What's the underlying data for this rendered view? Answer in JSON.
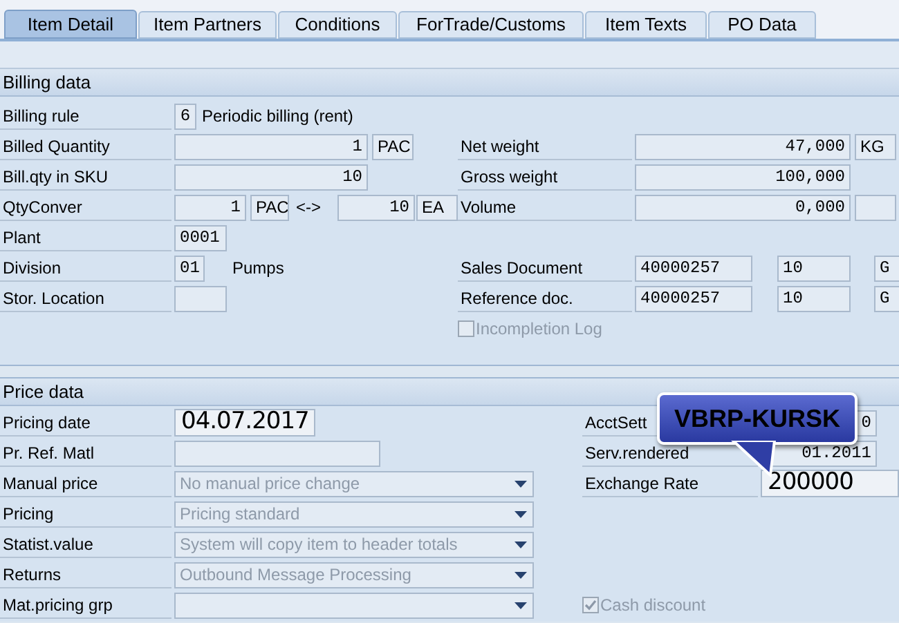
{
  "tabs": [
    {
      "label": "Item Detail",
      "selected": true
    },
    {
      "label": "Item Partners",
      "selected": false
    },
    {
      "label": "Conditions",
      "selected": false
    },
    {
      "label": "ForTrade/Customs",
      "selected": false
    },
    {
      "label": "Item Texts",
      "selected": false
    },
    {
      "label": "PO Data",
      "selected": false
    }
  ],
  "sections": [
    {
      "title": "Billing data",
      "left": [
        {
          "label": "Billing rule",
          "parts": [
            {
              "kind": "input",
              "value": "6"
            },
            {
              "kind": "text",
              "value": "Periodic billing (rent)"
            }
          ]
        },
        {
          "label": "Billed Quantity",
          "parts": [
            {
              "kind": "input",
              "value": "1"
            },
            {
              "kind": "unit",
              "value": "PAC"
            }
          ]
        },
        {
          "label": "Bill.qty in SKU",
          "parts": [
            {
              "kind": "input",
              "value": "10"
            }
          ]
        },
        {
          "label": "QtyConver",
          "parts": [
            {
              "kind": "input",
              "value": "1"
            },
            {
              "kind": "unit",
              "value": "PAC"
            },
            {
              "kind": "text",
              "value": "<->"
            },
            {
              "kind": "input",
              "value": "10"
            },
            {
              "kind": "unit",
              "value": "EA"
            }
          ]
        },
        {
          "label": "Plant",
          "parts": [
            {
              "kind": "input",
              "value": "0001"
            }
          ]
        },
        {
          "label": "Division",
          "parts": [
            {
              "kind": "input",
              "value": "01"
            },
            {
              "kind": "text",
              "value": "Pumps"
            }
          ]
        },
        {
          "label": "Stor. Location",
          "parts": [
            {
              "kind": "input"
            }
          ]
        }
      ],
      "right_groups": [
        [
          {
            "label": "Net weight",
            "parts": [
              {
                "kind": "input",
                "value": "47,000"
              },
              {
                "kind": "unit",
                "value": "KG"
              }
            ]
          },
          {
            "label": "Gross weight",
            "parts": [
              {
                "kind": "input",
                "value": "100,000"
              }
            ]
          },
          {
            "label": "Volume",
            "parts": [
              {
                "kind": "input",
                "value": "0,000"
              },
              {
                "kind": "unit"
              }
            ]
          }
        ],
        [
          {
            "label": "Sales Document",
            "parts": [
              {
                "kind": "input",
                "value": "40000257"
              },
              {
                "kind": "input",
                "value": "10"
              },
              {
                "kind": "input",
                "value": "G"
              }
            ]
          },
          {
            "label": "Reference doc.",
            "parts": [
              {
                "kind": "input",
                "value": "40000257"
              },
              {
                "kind": "input",
                "value": "10"
              },
              {
                "kind": "input",
                "value": "G"
              }
            ]
          },
          {
            "kind": "checkbox",
            "label": "Incompletion Log",
            "checked": false,
            "disabled": true
          }
        ]
      ]
    },
    {
      "title": "Price data",
      "left": [
        {
          "label": "Pricing date",
          "parts": [
            {
              "kind": "date",
              "value": "04.07.2017"
            }
          ]
        },
        {
          "label": "Pr. Ref. Matl",
          "parts": [
            {
              "kind": "input"
            }
          ]
        },
        {
          "label": "Manual price",
          "parts": [
            {
              "kind": "select",
              "value": "No manual price change",
              "disabled": true
            }
          ]
        },
        {
          "label": "Pricing",
          "parts": [
            {
              "kind": "select",
              "value": "Pricing standard",
              "disabled": true
            }
          ]
        },
        {
          "label": "Statist.value",
          "parts": [
            {
              "kind": "select",
              "value": "System will copy item to header totals",
              "disabled": true
            }
          ]
        },
        {
          "label": "Returns",
          "parts": [
            {
              "kind": "select",
              "value": "Outbound Message Processing",
              "disabled": true
            }
          ]
        },
        {
          "label": "Mat.pricing grp",
          "parts": [
            {
              "kind": "select"
            }
          ]
        }
      ],
      "right_groups": [
        [
          {
            "label": "AcctSett",
            "parts": [
              {
                "kind": "input",
                "value": "0"
              }
            ]
          },
          {
            "label": "Serv.rendered",
            "parts": [
              {
                "kind": "input",
                "value": "01.2011"
              }
            ]
          },
          {
            "label": "Exchange Rate",
            "parts": [
              {
                "kind": "date",
                "value": "200000"
              }
            ]
          }
        ],
        [
          {
            "kind": "checkbox",
            "label": "Cash discount",
            "checked": true,
            "disabled": true
          }
        ]
      ]
    }
  ],
  "tooltip": {
    "text": "VBRP-KURSK"
  }
}
